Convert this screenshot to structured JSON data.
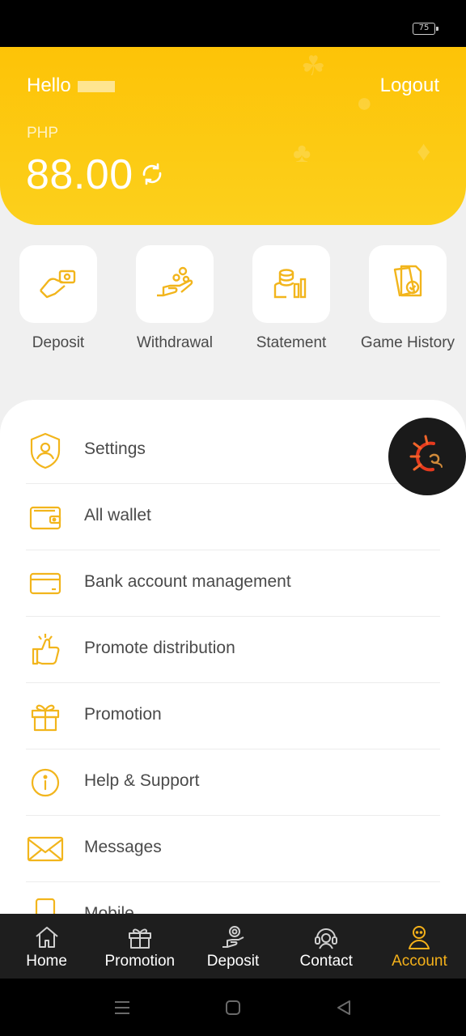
{
  "status_bar": {
    "battery": "75"
  },
  "header": {
    "greeting": "Hello",
    "logout_label": "Logout",
    "currency": "PHP",
    "balance": "88.00"
  },
  "quick_actions": [
    {
      "label": "Deposit",
      "icon": "hand-money-icon"
    },
    {
      "label": "Withdrawal",
      "icon": "hand-coins-icon"
    },
    {
      "label": "Statement",
      "icon": "coin-stack-chart-icon"
    },
    {
      "label": "Game History",
      "icon": "document-check-icon"
    }
  ],
  "menu": [
    {
      "label": "Settings",
      "icon": "shield-user-icon"
    },
    {
      "label": "All wallet",
      "icon": "wallet-icon"
    },
    {
      "label": "Bank account management",
      "icon": "bank-card-icon"
    },
    {
      "label": "Promote distribution",
      "icon": "thumbs-up-icon"
    },
    {
      "label": "Promotion",
      "icon": "gift-icon"
    },
    {
      "label": "Help & Support",
      "icon": "info-icon"
    },
    {
      "label": "Messages",
      "icon": "envelope-icon"
    },
    {
      "label": "Mobile",
      "icon": "mobile-icon"
    }
  ],
  "bottom_nav": [
    {
      "label": "Home",
      "icon": "home-icon"
    },
    {
      "label": "Promotion",
      "icon": "gift-icon"
    },
    {
      "label": "Deposit",
      "icon": "deposit-icon"
    },
    {
      "label": "Contact",
      "icon": "headset-icon"
    },
    {
      "label": "Account",
      "icon": "user-icon",
      "active": true
    }
  ],
  "colors": {
    "accent": "#fdc307",
    "icon_gold": "#f2b51c",
    "nav_active": "#f5b11a",
    "nav_bg": "#1e1e1e"
  }
}
